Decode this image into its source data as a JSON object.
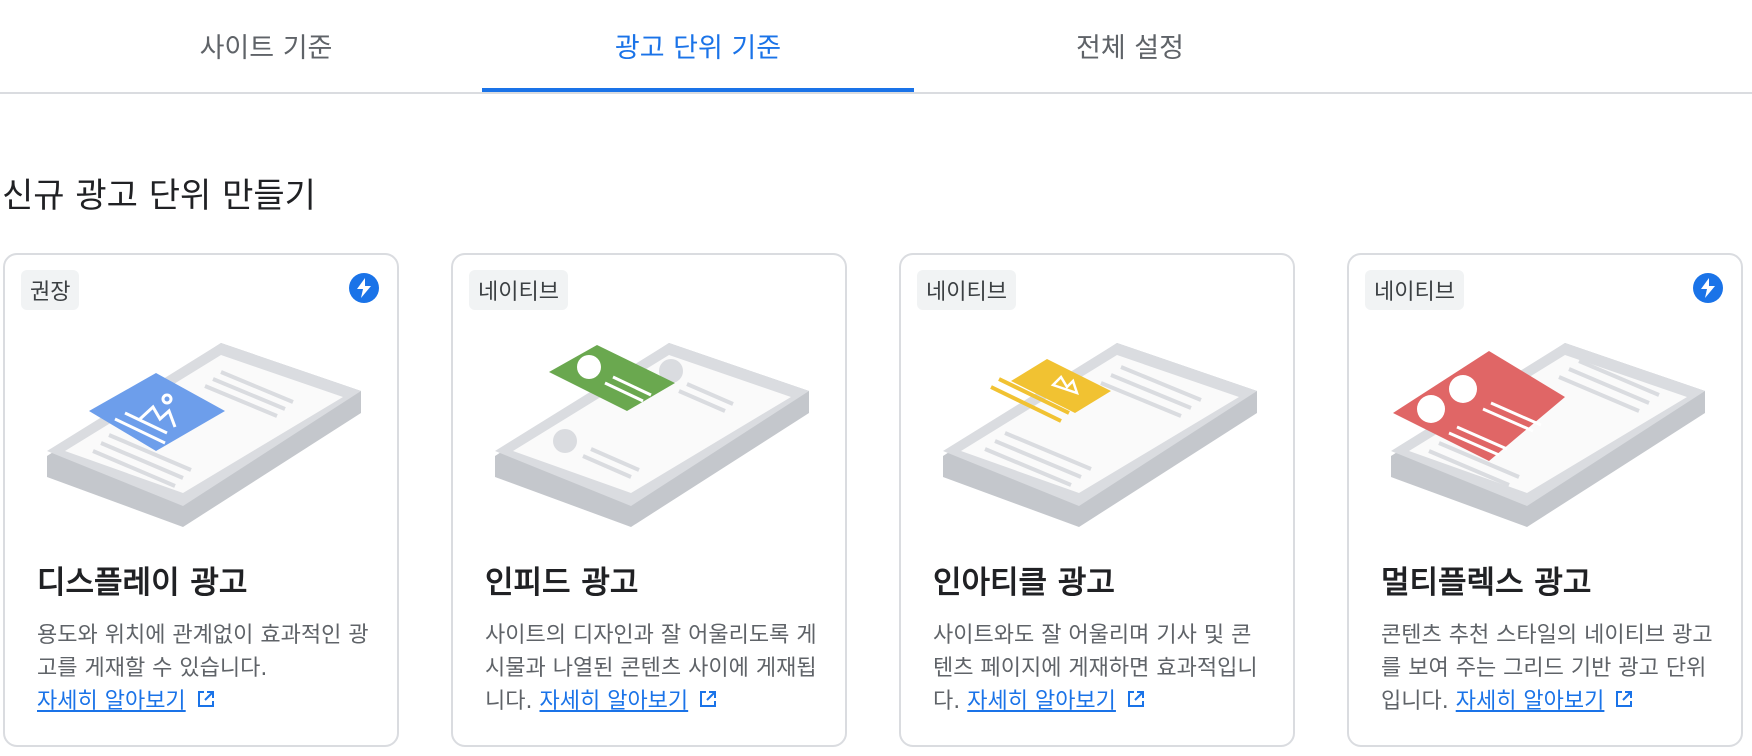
{
  "tabs": [
    {
      "label": "사이트 기준"
    },
    {
      "label": "광고 단위 기준"
    },
    {
      "label": "전체 설정"
    }
  ],
  "heading": "신규 광고 단위 만들기",
  "colors": {
    "accent": "#1a73e8",
    "display": "#6d9eeb",
    "infeed": "#6aa84f",
    "inarticle": "#f1c232",
    "multiplex": "#e06666"
  },
  "cards": [
    {
      "badge": "권장",
      "amp_icon": "bolt-icon",
      "title": "디스플레이 광고",
      "desc": "용도와 위치에 관계없이 효과적인 광고를 게재할 수 있습니다.",
      "link": "자세히 알아보기"
    },
    {
      "badge": "네이티브",
      "title": "인피드 광고",
      "desc": "사이트의 디자인과 잘 어울리도록 게시물과 나열된 콘텐츠 사이에 게재됩니다.",
      "link": "자세히 알아보기"
    },
    {
      "badge": "네이티브",
      "title": "인아티클 광고",
      "desc": "사이트와도 잘 어울리며 기사 및 콘텐츠 페이지에 게재하면 효과적입니다.",
      "link": "자세히 알아보기"
    },
    {
      "badge": "네이티브",
      "amp_icon": "bolt-icon",
      "title": "멀티플렉스 광고",
      "desc": "콘텐츠 추천 스타일의 네이티브 광고를 보여 주는 그리드 기반 광고 단위입니다.",
      "link": "자세히 알아보기"
    }
  ]
}
